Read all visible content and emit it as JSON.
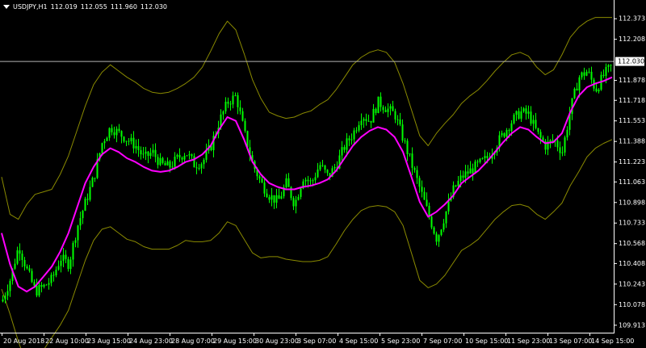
{
  "header": {
    "symbol": "USDJPY,H1",
    "open": "112.019",
    "high": "112.055",
    "low": "111.960",
    "close": "112.030",
    "icon": "dropdown-triangle-icon"
  },
  "colors": {
    "background": "#000000",
    "candle": "#00ff00",
    "ma": "#ff00ff",
    "bands": "#8a8a00",
    "price_line": "#b4b4b4",
    "axis": "#ffffff",
    "price_label_bg": "#ffffff",
    "price_label_fg": "#000000"
  },
  "chart_data": {
    "type": "candlestick",
    "symbol": "USDJPY",
    "timeframe": "H1",
    "ylim": [
      109.85,
      112.52
    ],
    "y_ticks": [
      "112.373",
      "112.208",
      "112.030",
      "111.878",
      "111.718",
      "111.553",
      "111.388",
      "111.223",
      "111.063",
      "110.898",
      "110.733",
      "110.568",
      "110.408",
      "110.243",
      "110.078",
      "109.913"
    ],
    "x_ticks": [
      "20 Aug 2018",
      "22 Aug 10:00",
      "23 Aug 15:00",
      "24 Aug 23:00",
      "28 Aug 07:00",
      "29 Aug 15:00",
      "30 Aug 23:00",
      "3 Sep 07:00",
      "4 Sep 15:00",
      "5 Sep 23:00",
      "7 Sep 07:00",
      "10 Sep 15:00",
      "11 Sep 23:00",
      "13 Sep 07:00",
      "14 Sep 15:00"
    ],
    "current_price": "112.030",
    "series": [
      {
        "role": "close-price",
        "values": [
          110.1,
          110.28,
          110.55,
          110.35,
          110.18,
          110.22,
          110.28,
          110.45,
          110.4,
          110.7,
          110.9,
          111.1,
          111.38,
          111.5,
          111.45,
          111.4,
          111.35,
          111.25,
          111.3,
          111.2,
          111.18,
          111.25,
          111.3,
          111.2,
          111.22,
          111.35,
          111.55,
          111.7,
          111.75,
          111.45,
          111.2,
          111.05,
          110.95,
          110.9,
          111.05,
          110.88,
          111.1,
          111.05,
          111.2,
          111.1,
          111.2,
          111.35,
          111.45,
          111.6,
          111.55,
          111.7,
          111.65,
          111.6,
          111.4,
          111.2,
          111.0,
          110.8,
          110.6,
          110.8,
          111.0,
          111.1,
          111.15,
          111.2,
          111.25,
          111.35,
          111.45,
          111.55,
          111.62,
          111.6,
          111.45,
          111.35,
          111.4,
          111.3,
          111.65,
          111.9,
          111.95,
          111.8,
          111.92,
          112.0
        ]
      },
      {
        "role": "moving-average",
        "values": [
          110.65,
          110.4,
          110.22,
          110.18,
          110.22,
          110.3,
          110.38,
          110.5,
          110.65,
          110.85,
          111.05,
          111.18,
          111.28,
          111.33,
          111.3,
          111.25,
          111.22,
          111.18,
          111.15,
          111.14,
          111.15,
          111.18,
          111.22,
          111.24,
          111.28,
          111.35,
          111.48,
          111.58,
          111.55,
          111.4,
          111.22,
          111.12,
          111.05,
          111.02,
          111.0,
          111.0,
          111.02,
          111.03,
          111.05,
          111.08,
          111.15,
          111.25,
          111.35,
          111.42,
          111.47,
          111.5,
          111.48,
          111.42,
          111.3,
          111.1,
          110.9,
          110.78,
          110.82,
          110.88,
          110.95,
          111.05,
          111.1,
          111.15,
          111.22,
          111.3,
          111.38,
          111.45,
          111.5,
          111.48,
          111.42,
          111.37,
          111.38,
          111.45,
          111.62,
          111.75,
          111.82,
          111.85,
          111.87,
          111.9
        ]
      },
      {
        "role": "upper-band",
        "values": [
          111.1,
          110.8,
          110.76,
          110.88,
          110.96,
          110.98,
          111.0,
          111.12,
          111.27,
          111.47,
          111.67,
          111.84,
          111.94,
          112.0,
          111.95,
          111.9,
          111.86,
          111.81,
          111.78,
          111.77,
          111.78,
          111.81,
          111.85,
          111.9,
          111.98,
          112.11,
          112.25,
          112.35,
          112.28,
          112.09,
          111.88,
          111.73,
          111.62,
          111.59,
          111.57,
          111.58,
          111.61,
          111.63,
          111.68,
          111.72,
          111.8,
          111.9,
          112.0,
          112.06,
          112.1,
          112.12,
          112.1,
          112.02,
          111.85,
          111.64,
          111.43,
          111.35,
          111.45,
          111.53,
          111.6,
          111.69,
          111.75,
          111.8,
          111.87,
          111.95,
          112.02,
          112.08,
          112.1,
          112.07,
          111.98,
          111.92,
          111.96,
          112.08,
          112.22,
          112.3,
          112.35,
          112.38,
          112.38,
          112.38
        ]
      },
      {
        "role": "lower-band",
        "values": [
          110.2,
          110.0,
          109.78,
          109.59,
          109.66,
          109.71,
          109.81,
          109.91,
          110.03,
          110.23,
          110.43,
          110.59,
          110.68,
          110.7,
          110.65,
          110.6,
          110.58,
          110.54,
          110.52,
          110.52,
          110.52,
          110.55,
          110.59,
          110.58,
          110.58,
          110.59,
          110.65,
          110.74,
          110.71,
          110.6,
          110.49,
          110.45,
          110.46,
          110.46,
          110.44,
          110.43,
          110.42,
          110.42,
          110.43,
          110.46,
          110.56,
          110.67,
          110.76,
          110.83,
          110.86,
          110.87,
          110.86,
          110.82,
          110.71,
          110.49,
          110.27,
          110.21,
          110.24,
          110.31,
          110.41,
          110.51,
          110.55,
          110.6,
          110.68,
          110.76,
          110.82,
          110.87,
          110.88,
          110.86,
          110.8,
          110.76,
          110.82,
          110.89,
          111.03,
          111.14,
          111.26,
          111.33,
          111.37,
          111.4
        ]
      }
    ]
  }
}
